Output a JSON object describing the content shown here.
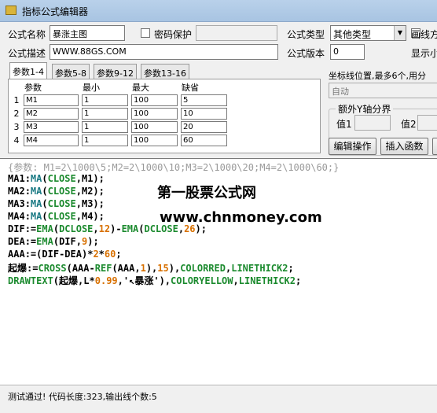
{
  "window": {
    "title": "指标公式编辑器"
  },
  "form": {
    "name_label": "公式名称",
    "name_value": "暴涨主图",
    "password_label": "密码保护",
    "type_label": "公式类型",
    "type_value": "其他类型",
    "draw_label": "画线方",
    "desc_label": "公式描述",
    "desc_value": "WWW.88GS.COM",
    "version_label": "公式版本",
    "version_value": "0",
    "display_label": "显示小"
  },
  "tabs": [
    "参数1-4",
    "参数5-8",
    "参数9-12",
    "参数13-16"
  ],
  "params": {
    "headers": [
      "参数",
      "最小",
      "最大",
      "缺省"
    ],
    "rows": [
      {
        "idx": "1",
        "name": "M1",
        "min": "1",
        "max": "100",
        "def": "5"
      },
      {
        "idx": "2",
        "name": "M2",
        "min": "1",
        "max": "100",
        "def": "10"
      },
      {
        "idx": "3",
        "name": "M3",
        "min": "1",
        "max": "100",
        "def": "20"
      },
      {
        "idx": "4",
        "name": "M4",
        "min": "1",
        "max": "100",
        "def": "60"
      }
    ]
  },
  "axis": {
    "label": "坐标线位置,最多6个,用分",
    "value": "自动",
    "group_title": "额外Y轴分界",
    "value1_label": "值1",
    "value2_label": "值2"
  },
  "buttons": {
    "edit_ops": "编辑操作",
    "insert_func": "插入函数"
  },
  "code": {
    "comment": "{参数: M1=2\\1000\\5;M2=2\\1000\\10;M3=2\\1000\\20;M4=2\\1000\\60;}",
    "ma_lines": [
      {
        "var": "MA1",
        "arg": "M1"
      },
      {
        "var": "MA2",
        "arg": "M2"
      },
      {
        "var": "MA3",
        "arg": "M3"
      },
      {
        "var": "MA4",
        "arg": "M4"
      }
    ],
    "fn_ma": "MA",
    "fn_ema": "EMA",
    "fn_ref": "REF",
    "fn_cross": "CROSS",
    "fn_drawtext": "DRAWTEXT",
    "kw_close": "CLOSE",
    "kw_dclose": "DCLOSE",
    "var_dif": "DIF",
    "var_dea": "DEA",
    "var_aaa": "AAA",
    "var_l": "L",
    "n12": "12",
    "n26": "26",
    "n9": "9",
    "n2": "2",
    "n60": "60",
    "n1": "1",
    "n15": "15",
    "n099": "0.99",
    "var_qibao": "起爆",
    "str_baozhang": "'↖暴涨'",
    "colorred": "COLORRED",
    "linethick2": "LINETHICK2",
    "coloryellow": "COLORYELLOW"
  },
  "watermark": {
    "line1": "第一股票公式网",
    "line2": "www.chnmoney.com"
  },
  "status": {
    "text": "测试通过! 代码长度:323,输出线个数:5"
  }
}
